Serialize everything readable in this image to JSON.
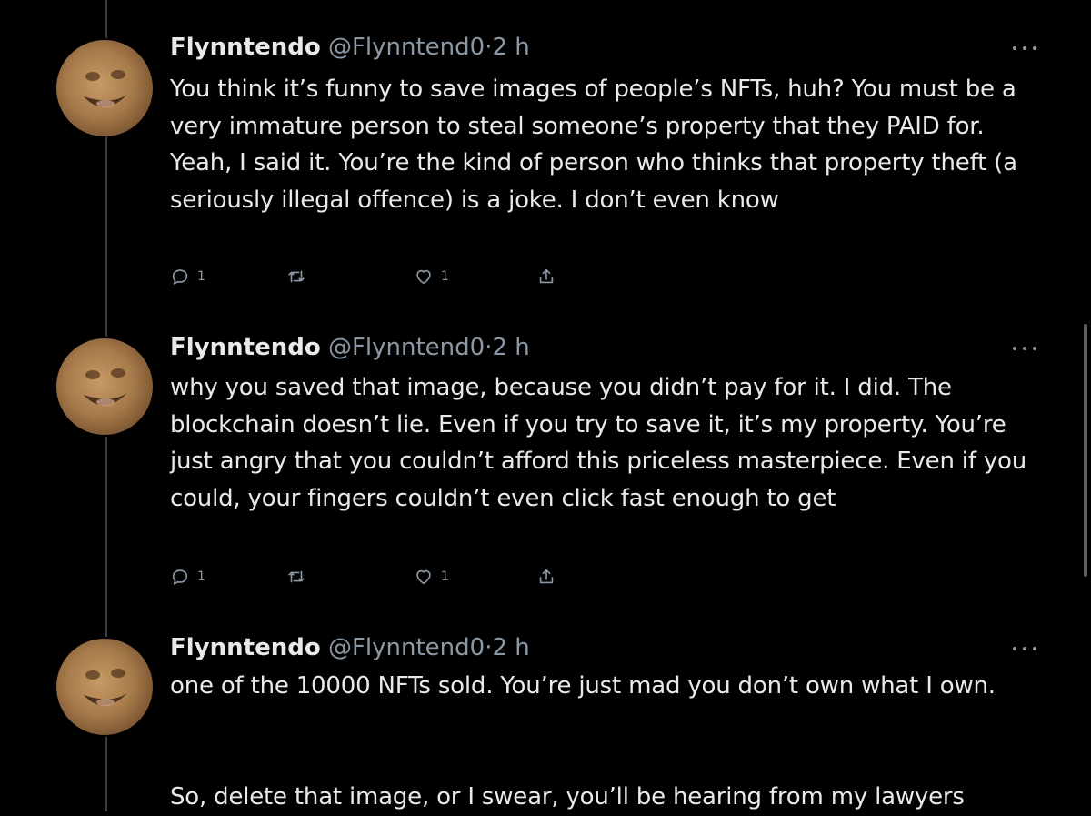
{
  "tweets": [
    {
      "display_name": "Flynntendo",
      "handle": "@Flynntend0",
      "separator": "·",
      "time": "2 h",
      "text": "You think it’s funny to save images of people’s NFTs, huh? You must be a very immature person to steal someone’s property that they PAID for. Yeah, I said it. You’re the kind of person who thinks that property theft (a seriously illegal offence) is a joke. I don’t even know",
      "replies": "1",
      "retweets": "",
      "likes": "1"
    },
    {
      "display_name": "Flynntendo",
      "handle": "@Flynntend0",
      "separator": "·",
      "time": "2 h",
      "text": "why you saved that image, because you didn’t pay for it. I did. The blockchain doesn’t lie. Even if you try to save it, it’s my property. You’re just angry that you couldn’t afford this priceless masterpiece. Even if you could, your fingers couldn’t even click fast enough to get",
      "replies": "1",
      "retweets": "",
      "likes": "1"
    },
    {
      "display_name": "Flynntendo",
      "handle": "@Flynntend0",
      "separator": "·",
      "time": "2 h",
      "text": "one of the 10000 NFTs sold. You’re just mad you don’t own what I own.",
      "text2": "So, delete that image, or I swear, you’ll be hearing from my lawyers"
    }
  ],
  "icons": {
    "reply": "reply-icon",
    "retweet": "retweet-icon",
    "like": "heart-icon",
    "share": "share-icon",
    "more": "more-icon"
  },
  "colors": {
    "background": "#000000",
    "text": "#e7e9ea",
    "secondary": "#8b98a5",
    "thread_line": "#3a3d41"
  }
}
